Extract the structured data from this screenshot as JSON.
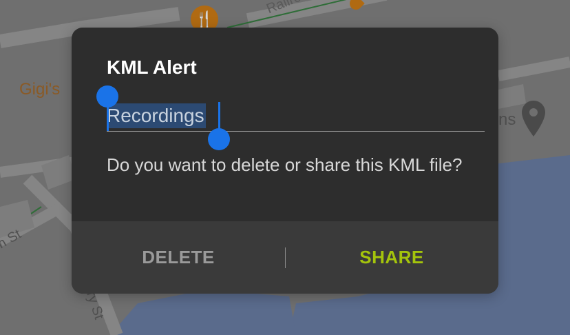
{
  "map": {
    "labels": {
      "gigis": "Gigi's",
      "railroad": "Railroa",
      "street_left": "n St",
      "street_bottom": "ry St",
      "partial_right": "ns"
    },
    "icons": [
      "restaurant-icon",
      "location-pin-icon"
    ],
    "colors": {
      "water": "#5a6b8c",
      "road": "#8a8a8a",
      "land": "#6f6f6f"
    }
  },
  "dialog": {
    "title": "KML Alert",
    "input_value": "Recordings",
    "message": "Do you want to delete or share this KML file?",
    "buttons": {
      "delete": "DELETE",
      "share": "SHARE"
    },
    "colors": {
      "background": "#2d2d2d",
      "actions_background": "#3a3a3a",
      "share": "#a4c40c",
      "delete": "#9a9a9a",
      "selection_handle": "#1a73e8"
    }
  }
}
